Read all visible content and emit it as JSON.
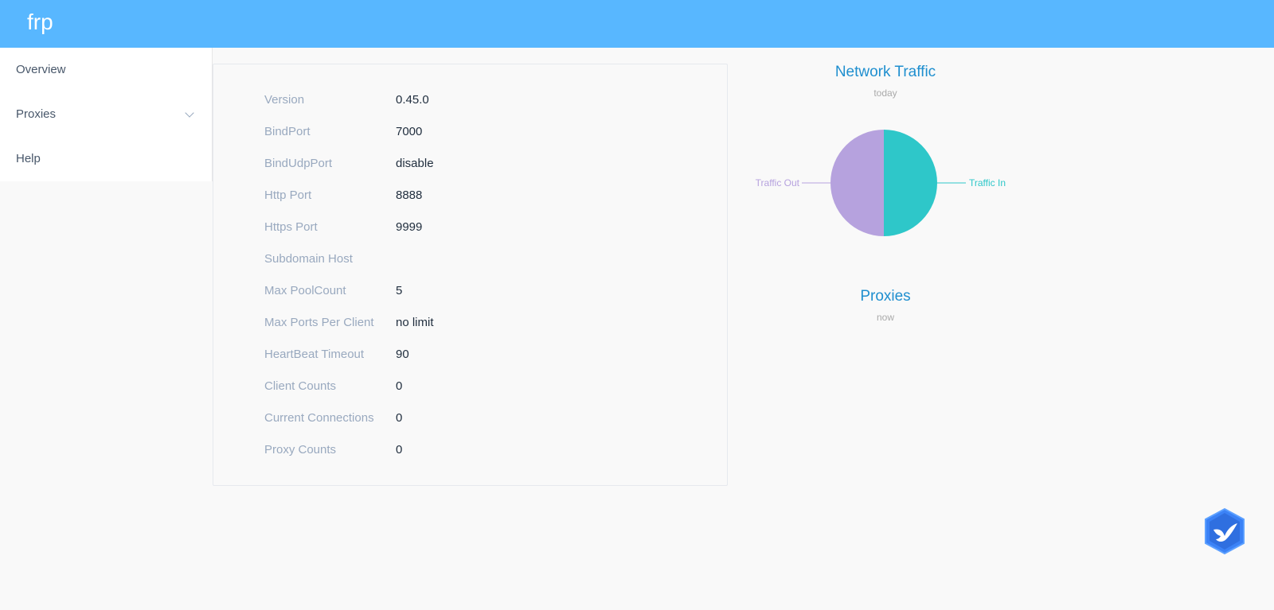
{
  "header": {
    "brand": "frp"
  },
  "sidebar": {
    "items": [
      {
        "label": "Overview"
      },
      {
        "label": "Proxies"
      },
      {
        "label": "Help"
      }
    ]
  },
  "server_info": [
    {
      "label": "Version",
      "value": "0.45.0"
    },
    {
      "label": "BindPort",
      "value": "7000"
    },
    {
      "label": "BindUdpPort",
      "value": "disable"
    },
    {
      "label": "Http Port",
      "value": "8888"
    },
    {
      "label": "Https Port",
      "value": "9999"
    },
    {
      "label": "Subdomain Host",
      "value": ""
    },
    {
      "label": "Max PoolCount",
      "value": "5"
    },
    {
      "label": "Max Ports Per Client",
      "value": "no limit"
    },
    {
      "label": "HeartBeat Timeout",
      "value": "90"
    },
    {
      "label": "Client Counts",
      "value": "0"
    },
    {
      "label": "Current Connections",
      "value": "0"
    },
    {
      "label": "Proxy Counts",
      "value": "0"
    }
  ],
  "traffic_chart": {
    "title": "Network Traffic",
    "subtitle": "today",
    "legend_out": "Traffic Out",
    "legend_in": "Traffic In"
  },
  "proxies_chart": {
    "title": "Proxies",
    "subtitle": "now"
  },
  "chart_data": {
    "type": "pie",
    "title": "Network Traffic",
    "subtitle": "today",
    "categories": [
      "Traffic In",
      "Traffic Out"
    ],
    "values": [
      50,
      50
    ],
    "colors": [
      "#2ec7c9",
      "#b6a2de"
    ]
  },
  "colors": {
    "header": "#58b7ff",
    "traffic_in": "#2ec7c9",
    "traffic_out": "#b6a2de",
    "chart_title": "#1f8fcf"
  },
  "floating_badge": {
    "icon": "bird-icon"
  }
}
